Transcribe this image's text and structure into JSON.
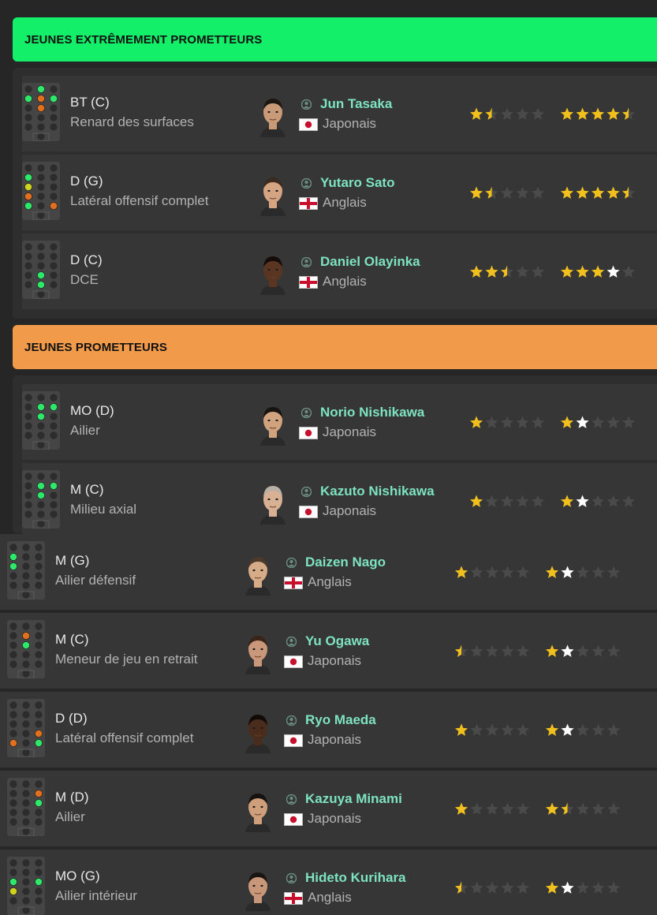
{
  "sections": [
    {
      "title": "JEUNES EXTRÊMEMENT PROMETTEURS",
      "color": "#14ef69"
    },
    {
      "title": "JEUNES PROMETTEURS",
      "color": "#f09a4a"
    }
  ],
  "icons": {
    "person": "person-icon",
    "flag": "flag-icon",
    "star": "star-icon"
  },
  "colors": {
    "name": "#7de3c0",
    "star_gold": "#f2c01d",
    "star_white": "#ffffff",
    "star_empty": "#4a4a4a"
  },
  "players": [
    {
      "position": "BT (C)",
      "role": "Renard des surfaces",
      "name": "Jun Tasaka",
      "nationality": "Japonais",
      "flag": "jp",
      "skin": "#c99a78",
      "hair": "#1d1714",
      "current": 1.5,
      "potential": 4.5,
      "dots": [
        [
          1,
          0,
          "g"
        ],
        [
          1,
          1,
          "o"
        ],
        [
          0,
          1,
          "g"
        ],
        [
          2,
          1,
          "g"
        ],
        [
          1,
          2,
          "o"
        ]
      ]
    },
    {
      "position": "D (G)",
      "role": "Latéral offensif complet",
      "name": "Yutaro Sato",
      "nationality": "Anglais",
      "flag": "en",
      "skin": "#d4a483",
      "hair": "#3a2a1f",
      "current": 1.5,
      "potential": 4.5,
      "dots": [
        [
          0,
          1,
          "g"
        ],
        [
          0,
          2,
          "y"
        ],
        [
          0,
          3,
          "o"
        ],
        [
          0,
          4,
          "g"
        ],
        [
          2,
          4,
          "o"
        ]
      ]
    },
    {
      "position": "D (C)",
      "role": "DCE",
      "name": "Daniel Olayinka",
      "nationality": "Anglais",
      "flag": "en",
      "skin": "#5a3522",
      "hair": "#140c08",
      "current": 2.5,
      "potential": 4,
      "dots": [
        [
          1,
          3,
          "g"
        ],
        [
          1,
          4,
          "g"
        ]
      ]
    },
    {
      "position": "MO (D)",
      "role": "Ailier",
      "name": "Norio Nishikawa",
      "nationality": "Japonais",
      "flag": "jp",
      "skin": "#d0a27e",
      "hair": "#161210",
      "current": 1,
      "potential": 2,
      "dots": [
        [
          1,
          1,
          "g"
        ],
        [
          2,
          1,
          "g"
        ],
        [
          1,
          2,
          "g"
        ]
      ]
    },
    {
      "position": "M (C)",
      "role": "Milieu axial",
      "name": "Kazuto Nishikawa",
      "nationality": "Japonais",
      "flag": "jp",
      "skin": "#d8b094",
      "hair": "#b8b0a6",
      "current": 1,
      "potential": 2,
      "dots": [
        [
          1,
          1,
          "g"
        ],
        [
          2,
          1,
          "g"
        ],
        [
          1,
          2,
          "g"
        ]
      ]
    },
    {
      "position": "M (G)",
      "role": "Ailier défensif",
      "name": "Daizen Nago",
      "nationality": "Anglais",
      "flag": "en",
      "skin": "#d6ab88",
      "hair": "#4d3a2a",
      "current": 1,
      "potential": 2,
      "dots": [
        [
          0,
          1,
          "g"
        ],
        [
          0,
          2,
          "g"
        ]
      ]
    },
    {
      "position": "M (C)",
      "role": "Meneur de jeu en retrait",
      "name": "Yu Ogawa",
      "nationality": "Japonais",
      "flag": "jp",
      "skin": "#c9987a",
      "hair": "#3a2418",
      "current": 0.5,
      "potential": 2,
      "dots": [
        [
          1,
          1,
          "o"
        ],
        [
          1,
          2,
          "g"
        ]
      ]
    },
    {
      "position": "D (D)",
      "role": "Latéral offensif complet",
      "name": "Ryo Maeda",
      "nationality": "Japonais",
      "flag": "jp",
      "skin": "#4a2c1c",
      "hair": "#120a06",
      "current": 1,
      "potential": 2,
      "dots": [
        [
          2,
          3,
          "o"
        ],
        [
          0,
          4,
          "o"
        ],
        [
          2,
          4,
          "g"
        ]
      ]
    },
    {
      "position": "M (D)",
      "role": "Ailier",
      "name": "Kazuya Minami",
      "nationality": "Japonais",
      "flag": "jp",
      "skin": "#cf9f7c",
      "hair": "#161210",
      "current": 1,
      "potential": 1.5,
      "dots": [
        [
          2,
          1,
          "o"
        ],
        [
          2,
          2,
          "g"
        ]
      ]
    },
    {
      "position": "MO (G)",
      "role": "Ailier intérieur",
      "name": "Hideto Kurihara",
      "nationality": "Anglais",
      "flag": "en",
      "skin": "#c8977a",
      "hair": "#1a1512",
      "current": 0.5,
      "potential": 2,
      "dots": [
        [
          0,
          2,
          "g"
        ],
        [
          2,
          2,
          "g"
        ],
        [
          0,
          3,
          "y"
        ]
      ]
    }
  ]
}
